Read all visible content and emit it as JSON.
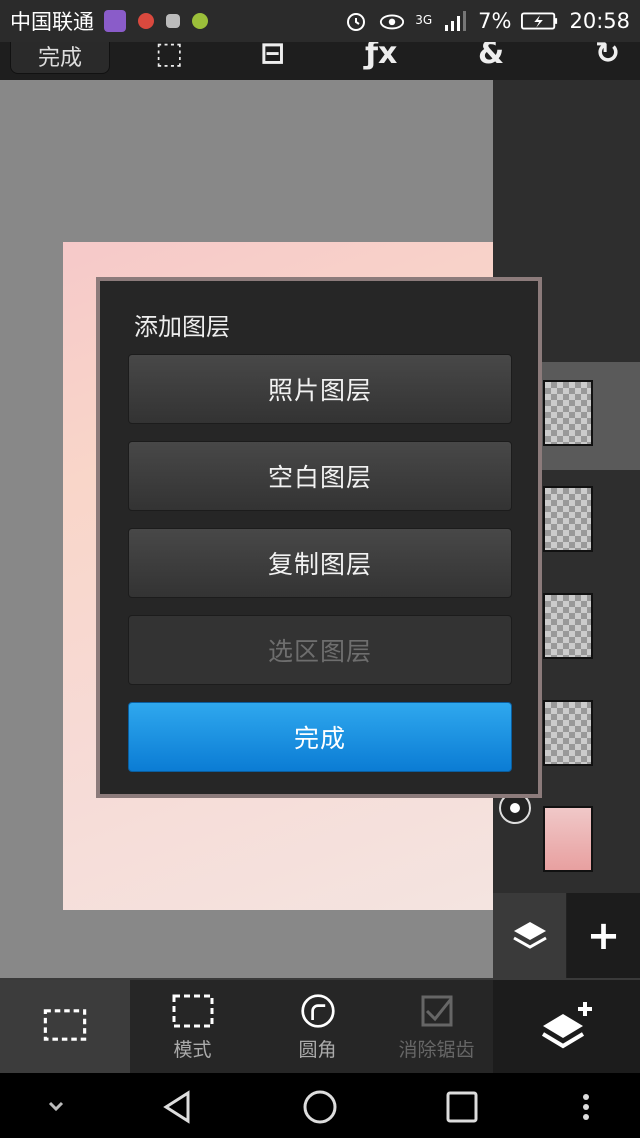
{
  "status_bar": {
    "carrier": "中国联通",
    "network": "3G",
    "battery": "7%",
    "time": "20:58"
  },
  "top_toolbar": {
    "done_label": "完成"
  },
  "dialog": {
    "title": "添加图层",
    "buttons": [
      {
        "label": "照片图层",
        "enabled": true
      },
      {
        "label": "空白图层",
        "enabled": true
      },
      {
        "label": "复制图层",
        "enabled": true
      },
      {
        "label": "选区图层",
        "enabled": false
      }
    ],
    "done_label": "完成"
  },
  "bottom_toolbar": {
    "items": [
      {
        "label": "",
        "icon": "selection-rect-icon"
      },
      {
        "label": "模式",
        "icon": "dashed-rect-icon"
      },
      {
        "label": "圆角",
        "icon": "rounded-corner-icon"
      },
      {
        "label": "消除锯齿",
        "icon": "antialias-check-icon"
      }
    ]
  },
  "colors": {
    "primary_button": "#1a8fe0",
    "panel": "#262626"
  }
}
